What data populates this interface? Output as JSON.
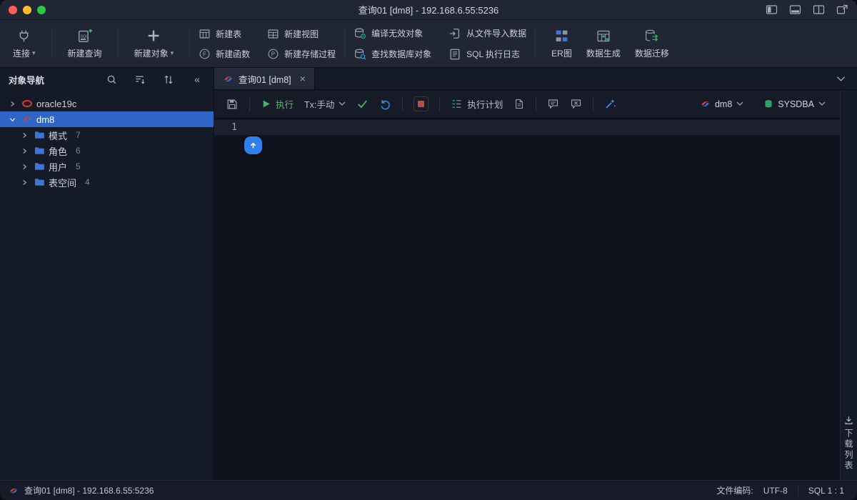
{
  "window": {
    "title": "查询01 [dm8]  - 192.168.6.55:5236"
  },
  "colors": {
    "selection_blue": "#2f65c6",
    "accent_green": "#43b564",
    "stop_red": "#c14848",
    "badge_blue": "#2f80ed",
    "traffic_red": "#ff5f57",
    "traffic_yellow": "#febc2e",
    "traffic_green": "#28c840"
  },
  "icons": {
    "chevron_down": "▾",
    "collapse_left": "«",
    "close": "×",
    "sql_badge": "SQL",
    "function_badge": "F",
    "procedure_badge": "P"
  },
  "toolbar": {
    "connect": "连接",
    "new_query": "新建查询",
    "new_object": "新建对象",
    "new_table": "新建表",
    "new_function": "新建函数",
    "new_view": "新建视图",
    "new_procedure": "新建存储过程",
    "compile_invalid": "编译无效对象",
    "find_db_object": "查找数据库对象",
    "import_from_file": "从文件导入数据",
    "sql_log": "SQL 执行日志",
    "er_diagram": "ER图",
    "data_generate": "数据生成",
    "data_migrate": "数据迁移"
  },
  "sidebar": {
    "title": "对象导航",
    "tree": [
      {
        "label": "oracle19c",
        "count": ""
      },
      {
        "label": "dm8",
        "count": ""
      },
      {
        "label": "模式",
        "count": "7"
      },
      {
        "label": "角色",
        "count": "6"
      },
      {
        "label": "用户",
        "count": "5"
      },
      {
        "label": "表空间",
        "count": "4"
      }
    ]
  },
  "tabs": [
    {
      "label": "查询01 [dm8]"
    }
  ],
  "editor_toolbar": {
    "execute": "执行",
    "tx_mode": "Tx:手动",
    "explain": "执行计划",
    "connection": "dm8",
    "role": "SYSDBA"
  },
  "editor": {
    "line_number": "1"
  },
  "right_panel": {
    "download_list": "下载列表"
  },
  "status_bar": {
    "connection": "查询01 [dm8] - 192.168.6.55:5236",
    "encoding_label": "文件编码:",
    "encoding_value": "UTF-8",
    "cursor_position": "SQL 1 : 1"
  }
}
